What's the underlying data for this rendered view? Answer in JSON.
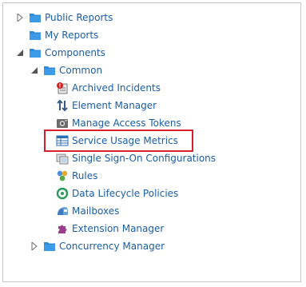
{
  "tree": {
    "nodes": [
      {
        "label": "Public Reports",
        "expander": "collapsed",
        "icon": "folder-icon"
      },
      {
        "label": "My Reports",
        "expander": "none",
        "icon": "folder-icon"
      },
      {
        "label": "Components",
        "expander": "expanded",
        "icon": "folder-icon"
      },
      {
        "label": "Common",
        "expander": "expanded",
        "icon": "folder-icon"
      },
      {
        "label": "Archived Incidents",
        "icon": "archived-incidents-icon"
      },
      {
        "label": "Element Manager",
        "icon": "element-manager-icon"
      },
      {
        "label": "Manage Access Tokens",
        "icon": "access-token-icon"
      },
      {
        "label": "Service Usage Metrics",
        "icon": "metrics-table-icon",
        "highlighted": true
      },
      {
        "label": "Single Sign-On Configurations",
        "icon": "sso-icon"
      },
      {
        "label": "Rules",
        "icon": "rules-icon"
      },
      {
        "label": "Data Lifecycle Policies",
        "icon": "lifecycle-icon"
      },
      {
        "label": "Mailboxes",
        "icon": "mailbox-icon"
      },
      {
        "label": "Extension Manager",
        "icon": "puzzle-icon"
      },
      {
        "label": "Concurrency Manager",
        "expander": "collapsed",
        "icon": "folder-icon"
      }
    ]
  },
  "colors": {
    "link": "#1b5ea8",
    "folder": "#2f8ad8",
    "highlight": "#d91f2b",
    "border": "#c4c8cc"
  }
}
